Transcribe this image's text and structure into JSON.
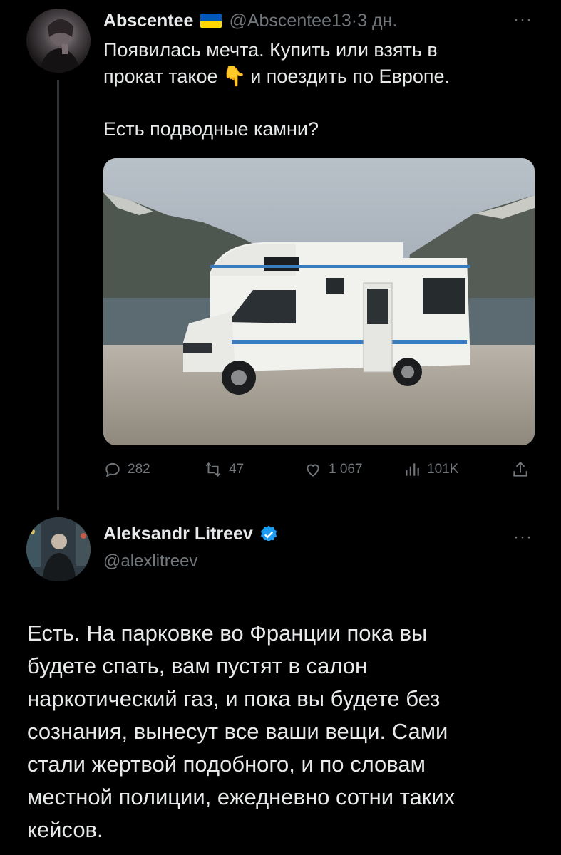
{
  "tweet1": {
    "author": "Abscentee",
    "handle": "@Abscentee13",
    "separator": " · ",
    "time": "3 дн.",
    "more": "···",
    "lines": [
      "Появилась мечта. Купить или взять в",
      "прокат такое",
      "и поездить по Европе.",
      "",
      "Есть подводные камни?"
    ],
    "emoji": "👇",
    "media_alt": "motorhome",
    "actions": {
      "replies": "282",
      "reposts": "47",
      "likes": "1 067",
      "views": "101K"
    }
  },
  "tweet2": {
    "author": "Aleksandr Litreev",
    "handle": "@alexlitreev",
    "more": "···",
    "lines": [
      "Есть. На парковке во Франции пока вы",
      "будете спать, вам пустят в салон",
      "наркотический газ, и пока вы будете без",
      "сознания, вынесут все ваши вещи. Сами",
      "стали жертвой подобного, и по словам",
      "местной полиции, ежедневно сотни таких",
      "кейсов."
    ]
  },
  "colors": {
    "background": "#000000",
    "text": "#e7e9ea",
    "muted": "#71767b",
    "verified": "#1d9bf0",
    "flag_blue": "#0057b7",
    "flag_yellow": "#ffd700"
  },
  "icons": [
    "reply-icon",
    "repost-icon",
    "like-icon",
    "views-icon",
    "share-icon",
    "verified-icon",
    "more-icon"
  ]
}
